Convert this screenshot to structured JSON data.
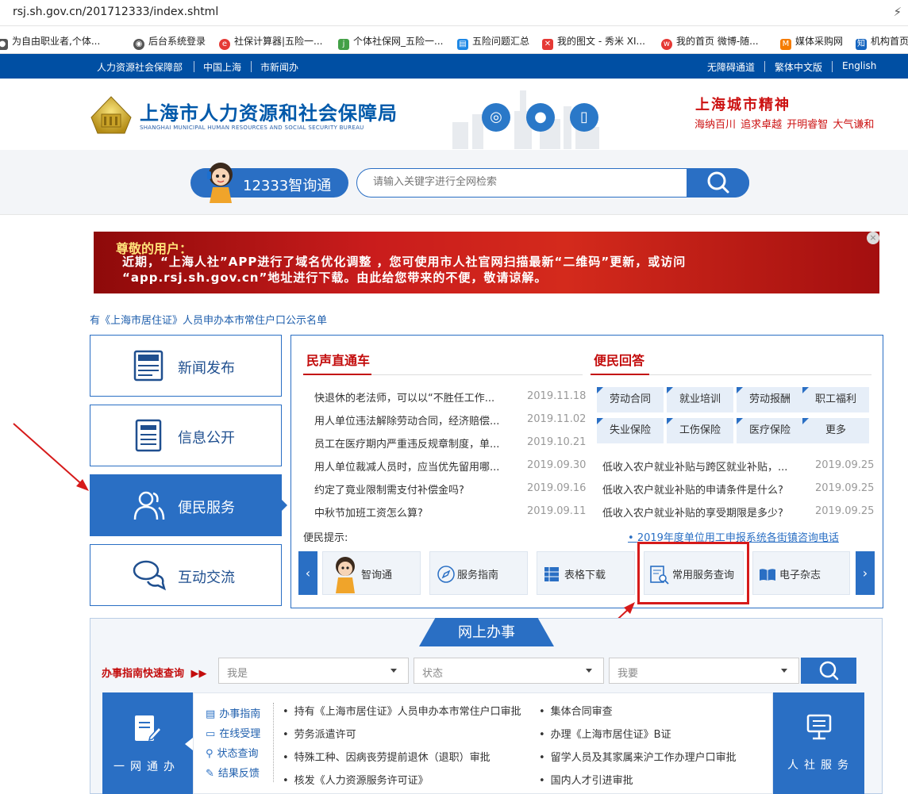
{
  "browser": {
    "url": "rsj.sh.gov.cn/201712333/index.shtml",
    "bookmarks": [
      {
        "label": "为自由职业者,个体...",
        "icon": "camera-icon",
        "color": "#555555"
      },
      {
        "label": "后台系统登录",
        "icon": "globe-icon",
        "color": "#555555"
      },
      {
        "label": "社保计算器|五险一...",
        "icon": "e-icon",
        "color": "#e53935"
      },
      {
        "label": "个体社保网_五险一...",
        "icon": "j-icon",
        "color": "#43a047"
      },
      {
        "label": "五险问题汇总",
        "icon": "doc-icon",
        "color": "#1e88e5"
      },
      {
        "label": "我的图文 - 秀米 XI...",
        "icon": "xiumi-icon",
        "color": "#e53935"
      },
      {
        "label": "我的首页 微博-随...",
        "icon": "weibo-icon",
        "color": "#e53935"
      },
      {
        "label": "媒体采购网",
        "icon": "m-icon",
        "color": "#f57c00"
      },
      {
        "label": "机构首页",
        "icon": "zhi-icon",
        "color": "#1565c0"
      }
    ]
  },
  "topbar": {
    "left": [
      "人力资源社会保障部",
      "中国上海",
      "市新闻办"
    ],
    "right": [
      "无障碍通道",
      "繁体中文版",
      "English"
    ]
  },
  "header": {
    "title": "上海市人力资源和社会保障局",
    "title_en": "SHANGHAI MUNICIPAL HUMAN RESOURCES AND SOCIAL SECURITY BUREAU",
    "social_icons": [
      "weibo-icon",
      "wechat-icon",
      "mobile-icon"
    ],
    "spirit_title": "上海城市精神",
    "spirit_sub": "海纳百川 追求卓越 开明睿智 大气谦和"
  },
  "search": {
    "assistant_label": "12333智询通",
    "placeholder": "请输入关键字进行全网检索"
  },
  "banner": {
    "line1": "尊敬的用户：",
    "line2": "近期，“上海人社”APP进行了域名优化调整 ，您可使用市人社官网扫描最新“二维码”更新，或访问",
    "line3": "“app.rsj.sh.gov.cn”地址进行下载。由此给您带来的不便，敬请谅解。",
    "close": "×"
  },
  "notice": "有《上海市居住证》人员申办本市常住户口公示名单",
  "left_nav": [
    {
      "label": "新闻发布",
      "icon": "news-icon",
      "active": false
    },
    {
      "label": "信息公开",
      "icon": "document-icon",
      "active": false
    },
    {
      "label": "便民服务",
      "icon": "users-icon",
      "active": true
    },
    {
      "label": "互动交流",
      "icon": "chat-icon",
      "active": false
    }
  ],
  "minsheng": {
    "title": "民声直通车",
    "items": [
      {
        "text": "快退休的老法师，可以以“不胜任工作...",
        "date": "2019.11.18"
      },
      {
        "text": "用人单位违法解除劳动合同，经济赔偿...",
        "date": "2019.11.02"
      },
      {
        "text": "员工在医疗期内严重违反规章制度，单...",
        "date": "2019.10.21"
      },
      {
        "text": "用人单位裁减人员时，应当优先留用哪...",
        "date": "2019.09.30"
      },
      {
        "text": "约定了竟业限制需支付补偿金吗?",
        "date": "2019.09.16"
      },
      {
        "text": "中秋节加班工资怎么算?",
        "date": "2019.09.11"
      }
    ]
  },
  "bianmin_qa": {
    "title": "便民回答",
    "tags": [
      "劳动合同",
      "就业培训",
      "劳动报酬",
      "职工福利",
      "失业保险",
      "工伤保险",
      "医疗保险",
      "更多"
    ],
    "items": [
      {
        "text": "低收入农户就业补贴与跨区就业补贴，...",
        "date": "2019.09.25"
      },
      {
        "text": "低收入农户就业补贴的申请条件是什么?",
        "date": "2019.09.25"
      },
      {
        "text": "低收入农户就业补贴的享受期限是多少?",
        "date": "2019.09.25"
      }
    ]
  },
  "tips": {
    "label": "便民提示:",
    "link": "2019年度单位用工申报系统各街镇咨询电话",
    "cards": [
      {
        "label": "智询通",
        "icon": "assistant-icon"
      },
      {
        "label": "服务指南",
        "icon": "compass-icon"
      },
      {
        "label": "表格下载",
        "icon": "table-icon"
      },
      {
        "label": "常用服务查询",
        "icon": "search-doc-icon"
      },
      {
        "label": "电子杂志",
        "icon": "book-icon"
      }
    ],
    "prev": "‹",
    "next": "›"
  },
  "online": {
    "tab": "网上办事",
    "quick_label": "办事指南快速查询",
    "dropdowns": [
      "我是",
      "状态",
      "我要"
    ],
    "ywt_label": "一网通办",
    "rsfw_label": "人社服务",
    "side_links": [
      "办事指南",
      "在线受理",
      "状态查询",
      "结果反馈"
    ],
    "col1": [
      "持有《上海市居住证》人员申办本市常住户口审批",
      "劳务派遣许可",
      "特殊工种、因病丧劳提前退休（退职）审批",
      "核发《人力资源服务许可证》"
    ],
    "col2": [
      "集体合同审查",
      "办理《上海市居住证》B证",
      "留学人员及其家属来沪工作办理户口审批",
      "国内人才引进审批"
    ]
  },
  "colors": {
    "primary": "#2a6fc4",
    "topbar": "#004fa3",
    "accent_red": "#c30c0c",
    "highlight": "#d61a1a"
  }
}
